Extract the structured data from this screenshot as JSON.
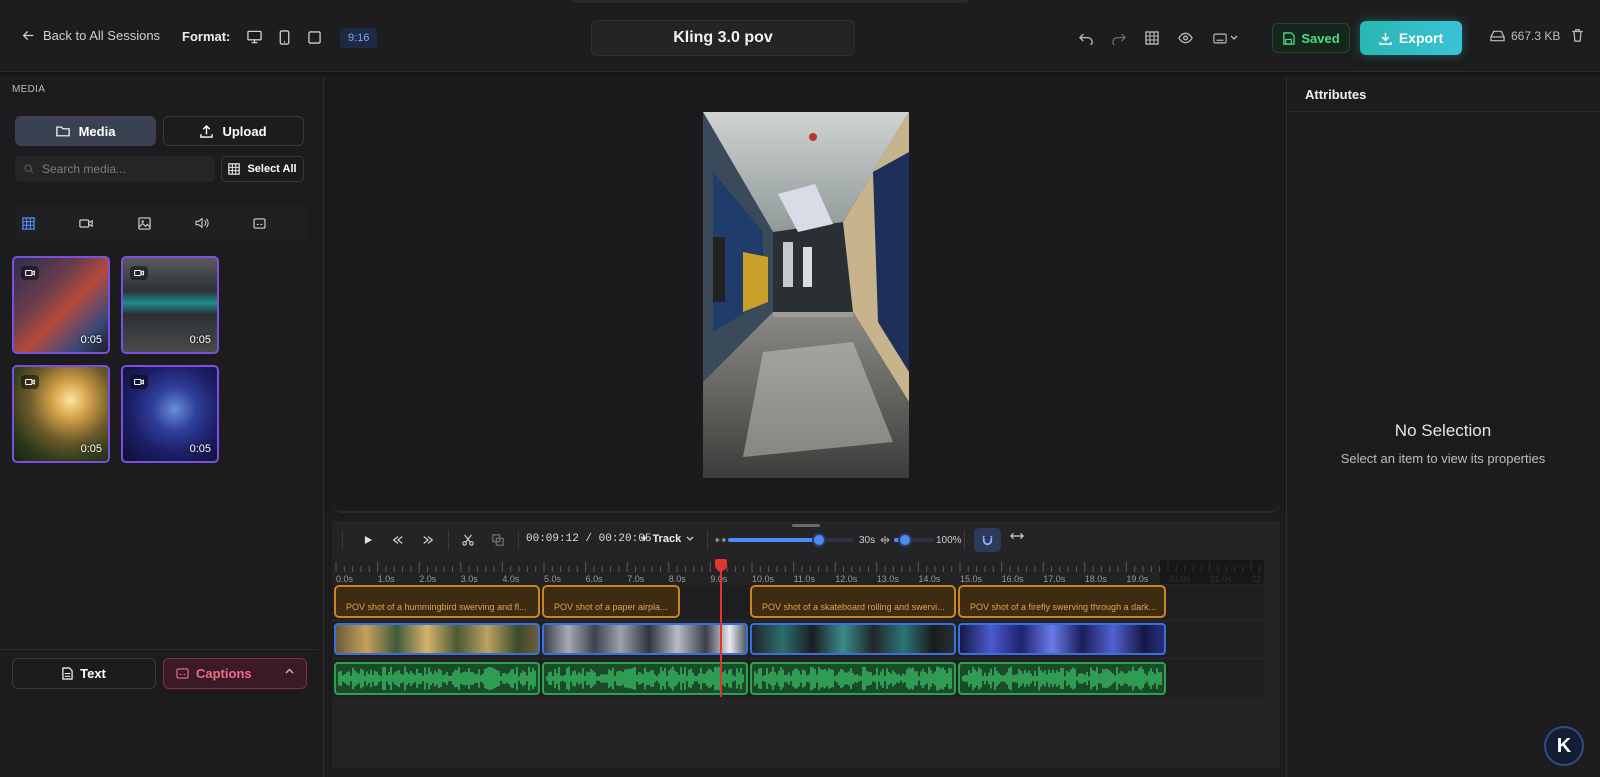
{
  "header": {
    "back_label": "Back to All Sessions",
    "format_label": "Format:",
    "aspect_ratio": "9:16",
    "project_title": "Kling 3.0 pov",
    "saved_label": "Saved",
    "export_label": "Export",
    "file_size": "667.3 KB",
    "format_icons": [
      "desktop-icon",
      "mobile-icon",
      "square-icon"
    ],
    "tool_icons": [
      "undo-icon",
      "redo-icon",
      "grid-icon",
      "eye-icon",
      "keyboard-icon"
    ]
  },
  "sidebar": {
    "section_title": "MEDIA",
    "media_tab": "Media",
    "upload_tab": "Upload",
    "search_placeholder": "Search media...",
    "select_all": "Select All",
    "filter_icons": [
      "grid-icon",
      "video-icon",
      "image-icon",
      "audio-icon",
      "caption-icon"
    ],
    "items": [
      {
        "duration": "0:05",
        "icon": "video-icon"
      },
      {
        "duration": "0:05",
        "icon": "video-icon"
      },
      {
        "duration": "0:05",
        "icon": "video-icon"
      },
      {
        "duration": "0:05",
        "icon": "video-icon"
      }
    ],
    "text_button": "Text",
    "captions_button": "Captions"
  },
  "timeline": {
    "current_time": "00:09:12",
    "total_time": "00:20:05",
    "track_label": "Track",
    "zoom_label": "30s",
    "volume_label": "100%",
    "ticks": [
      "0.0s",
      "1.0s",
      "2.0s",
      "3.0s",
      "4.0s",
      "5.0s",
      "6.0s",
      "7.0s",
      "8.0s",
      "9.0s",
      "10.0s",
      "11.0s",
      "12.0s",
      "13.0s",
      "14.0s",
      "15.0s",
      "16.0s",
      "17.0s",
      "18.0s",
      "19.0s",
      "20.0s",
      "21.0s",
      "22.0s"
    ],
    "caption_clips": [
      "POV shot of a hummingbird swerving and fl...",
      "POV shot of a paper airpla...",
      "POV shot of a skateboard rolling and swervi...",
      "POV shot of a firefly swerving through a dark..."
    ],
    "playhead_seconds": 9.2,
    "colors": {
      "caption": "#c9851f",
      "video": "#3b6fd9",
      "audio": "#2ba24f",
      "playhead": "#e3342f"
    }
  },
  "attributes": {
    "title": "Attributes",
    "empty_title": "No Selection",
    "empty_subtitle": "Select an item to view its properties"
  },
  "fab_label": "K"
}
